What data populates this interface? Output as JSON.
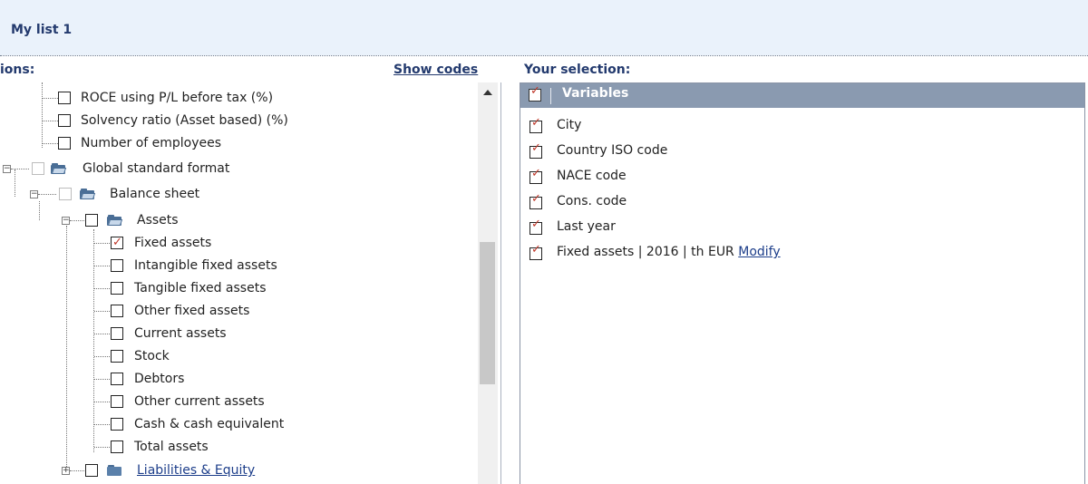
{
  "header": {
    "title": "My list 1"
  },
  "left_panel": {
    "label": "ions:",
    "show_codes": "Show codes",
    "items": [
      {
        "label": "ROCE using P/L before tax (%)",
        "checked": false
      },
      {
        "label": "Solvency ratio (Asset based) (%)",
        "checked": false
      },
      {
        "label": "Number of employees",
        "checked": false
      },
      {
        "label": "Global standard format",
        "checked": false,
        "folder": true,
        "expanded": true
      },
      {
        "label": "Balance sheet",
        "checked": false,
        "folder": true,
        "expanded": true
      },
      {
        "label": "Assets",
        "checked": false,
        "folder": true,
        "expanded": true
      },
      {
        "label": "Fixed assets",
        "checked": true
      },
      {
        "label": "Intangible fixed assets",
        "checked": false
      },
      {
        "label": "Tangible fixed assets",
        "checked": false
      },
      {
        "label": "Other fixed assets",
        "checked": false
      },
      {
        "label": "Current assets",
        "checked": false
      },
      {
        "label": "Stock",
        "checked": false
      },
      {
        "label": "Debtors",
        "checked": false
      },
      {
        "label": "Other current assets",
        "checked": false
      },
      {
        "label": "Cash & cash equivalent",
        "checked": false
      },
      {
        "label": "Total assets",
        "checked": false
      },
      {
        "label": "Liabilities & Equity",
        "checked": false,
        "folder": true,
        "expanded": false
      }
    ]
  },
  "right_panel": {
    "label": "Your selection:",
    "header": "Variables",
    "items": [
      {
        "label": "City",
        "checked": true
      },
      {
        "label": "Country ISO code",
        "checked": true
      },
      {
        "label": "NACE code",
        "checked": true
      },
      {
        "label": "Cons. code",
        "checked": true
      },
      {
        "label": "Last year",
        "checked": true
      },
      {
        "label": "Fixed assets | 2016 | th EUR",
        "checked": true,
        "modify": "Modify"
      }
    ]
  }
}
